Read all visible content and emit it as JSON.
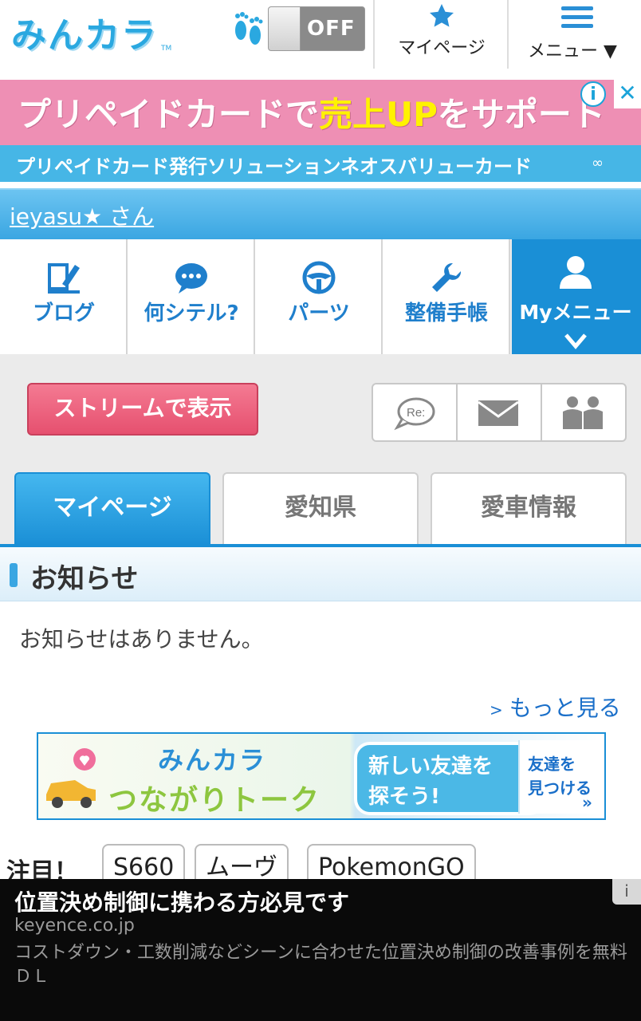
{
  "header": {
    "logo": "みんカラ",
    "logo_tm": "TM",
    "toggle_label": "OFF",
    "mypage_label": "マイページ",
    "menu_label": "メニュー ▼"
  },
  "ad_top": {
    "headline_a": "プリペイドカードで",
    "headline_b": "売上UP",
    "headline_c": "をサポート",
    "sub": "プリペイドカード発行ソリューションネオスバリューカード",
    "info": "i",
    "close": "✕"
  },
  "user": {
    "name": "ieyasu★ さん"
  },
  "nav": {
    "items": [
      {
        "label": "ブログ"
      },
      {
        "label": "何シテル?"
      },
      {
        "label": "パーツ"
      },
      {
        "label": "整備手帳"
      },
      {
        "label": "Myメニュー"
      }
    ]
  },
  "actions": {
    "stream_label": "ストリームで表示",
    "reply_icon_text": "Re:"
  },
  "tabs": [
    {
      "label": "マイページ"
    },
    {
      "label": "愛知県"
    },
    {
      "label": "愛車情報"
    }
  ],
  "notice": {
    "title": "お知らせ",
    "empty": "お知らせはありません。",
    "more": "もっと見る",
    "more_arrow": ">"
  },
  "banner": {
    "title_top": "みんカラ",
    "title_bottom": "つながりトーク",
    "bubble_l1": "新しい友達を",
    "bubble_l2": "探そう!",
    "side_l1": "友達を",
    "side_l2": "見つける",
    "side_arrow": "»"
  },
  "attention": {
    "label": "注目！",
    "tags": [
      "S660",
      "ムーヴ",
      "PokemonGO"
    ]
  },
  "bottom_ad": {
    "headline": "位置決め制御に携わる方必見です",
    "domain": "keyence.co.jp",
    "description": "コストダウン・工数削減などシーンに合わせた位置決め制御の改善事例を無料ＤＬ",
    "info": "i"
  },
  "colors": {
    "accent": "#1a8fd6",
    "pink": "#e6506f",
    "ad_pink": "#ee8fb4"
  }
}
